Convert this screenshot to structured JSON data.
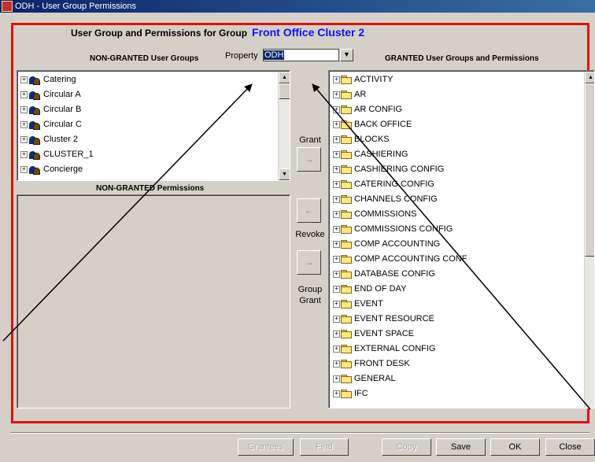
{
  "window": {
    "title": "ODH - User Group Permissions"
  },
  "header": {
    "prefix": "User Group and Permissions for Group",
    "group_name": "Front Office Cluster 2"
  },
  "labels": {
    "non_granted_groups": "NON-GRANTED User Groups",
    "non_granted_permissions": "NON-GRANTED Permissions",
    "granted": "GRANTED User Groups and Permissions",
    "property": "Property"
  },
  "property": {
    "value": "ODH"
  },
  "non_granted_groups": [
    "Catering",
    "Circular A",
    "Circular B",
    "Circular C",
    "Cluster 2",
    "CLUSTER_1",
    "Concierge"
  ],
  "granted_items": [
    "ACTIVITY",
    "AR",
    "AR CONFIG",
    "BACK OFFICE",
    "BLOCKS",
    "CASHIERING",
    "CASHIERING CONFIG",
    "CATERING CONFIG",
    "CHANNELS CONFIG",
    "COMMISSIONS",
    "COMMISSIONS CONFIG",
    "COMP ACCOUNTING",
    "COMP ACCOUNTING CONF",
    "DATABASE CONFIG",
    "END OF DAY",
    "EVENT",
    "EVENT RESOURCE",
    "EVENT SPACE",
    "EXTERNAL CONFIG",
    "FRONT DESK",
    "GENERAL",
    "IFC"
  ],
  "middle": {
    "grant": "Grant",
    "revoke": "Revoke",
    "group_grant_1": "Group",
    "group_grant_2": "Grant"
  },
  "footer": {
    "grantees": "Grantees",
    "find": "Find",
    "copy": "Copy",
    "save": "Save",
    "ok": "OK",
    "close": "Close"
  }
}
